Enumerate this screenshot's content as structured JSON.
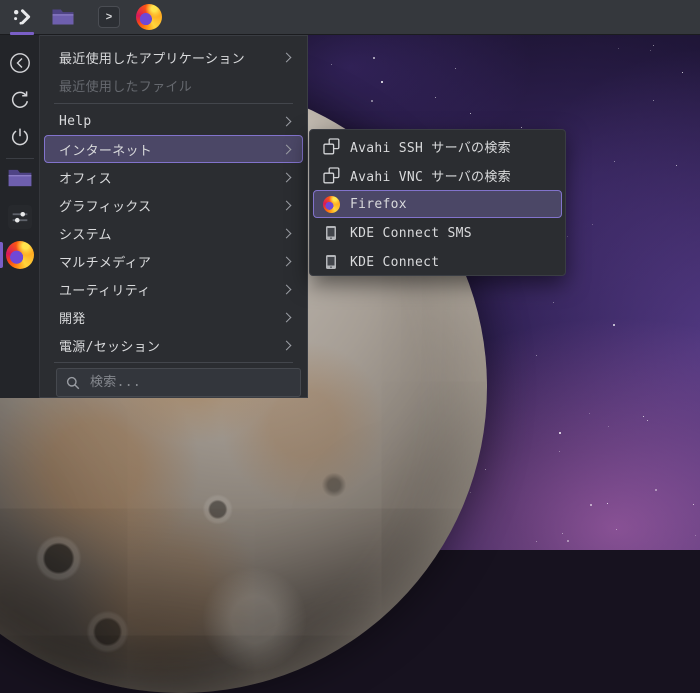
{
  "colors": {
    "accent": "#7a5fc7",
    "highlight_bg": "#4b4766",
    "highlight_border": "#8273cc"
  },
  "topbar": {
    "items": [
      {
        "id": "app-menu",
        "icon": "app-menu-icon",
        "active": true
      },
      {
        "id": "file-manager",
        "icon": "folder-icon",
        "active": false
      },
      {
        "id": "terminal",
        "icon": "terminal-icon",
        "active": false,
        "glyph": ">"
      },
      {
        "id": "firefox",
        "icon": "firefox-icon",
        "active": false
      }
    ]
  },
  "sidebar": {
    "items": [
      {
        "id": "back",
        "icon": "back-icon"
      },
      {
        "id": "restart",
        "icon": "restart-icon"
      },
      {
        "id": "shutdown",
        "icon": "power-icon"
      },
      {
        "id": "file-manager",
        "icon": "folder-icon"
      },
      {
        "id": "settings",
        "icon": "sliders-icon"
      },
      {
        "id": "firefox",
        "icon": "firefox-icon",
        "active": true
      }
    ]
  },
  "menu": {
    "items": [
      {
        "label": "最近使用したアプリケーション",
        "enabled": true,
        "has_submenu": true,
        "selected": false
      },
      {
        "label": "最近使用したファイル",
        "enabled": false,
        "has_submenu": false,
        "selected": false
      },
      {
        "label": "Help",
        "enabled": true,
        "has_submenu": true,
        "selected": false
      },
      {
        "label": "インターネット",
        "enabled": true,
        "has_submenu": true,
        "selected": true
      },
      {
        "label": "オフィス",
        "enabled": true,
        "has_submenu": true,
        "selected": false
      },
      {
        "label": "グラフィックス",
        "enabled": true,
        "has_submenu": true,
        "selected": false
      },
      {
        "label": "システム",
        "enabled": true,
        "has_submenu": true,
        "selected": false
      },
      {
        "label": "マルチメディア",
        "enabled": true,
        "has_submenu": true,
        "selected": false
      },
      {
        "label": "ユーティリティ",
        "enabled": true,
        "has_submenu": true,
        "selected": false
      },
      {
        "label": "開発",
        "enabled": true,
        "has_submenu": true,
        "selected": false
      },
      {
        "label": "電源/セッション",
        "enabled": true,
        "has_submenu": true,
        "selected": false
      }
    ],
    "search": {
      "placeholder": "検索...",
      "value": ""
    }
  },
  "submenu": {
    "items": [
      {
        "label": "Avahi SSH サーバの検索",
        "icon": "remote-desktop-icon",
        "selected": false
      },
      {
        "label": "Avahi VNC サーバの検索",
        "icon": "remote-desktop-icon",
        "selected": false
      },
      {
        "label": "Firefox",
        "icon": "firefox-icon",
        "selected": true
      },
      {
        "label": "KDE Connect SMS",
        "icon": "smartphone-icon",
        "selected": false
      },
      {
        "label": "KDE Connect",
        "icon": "smartphone-icon",
        "selected": false
      }
    ]
  }
}
